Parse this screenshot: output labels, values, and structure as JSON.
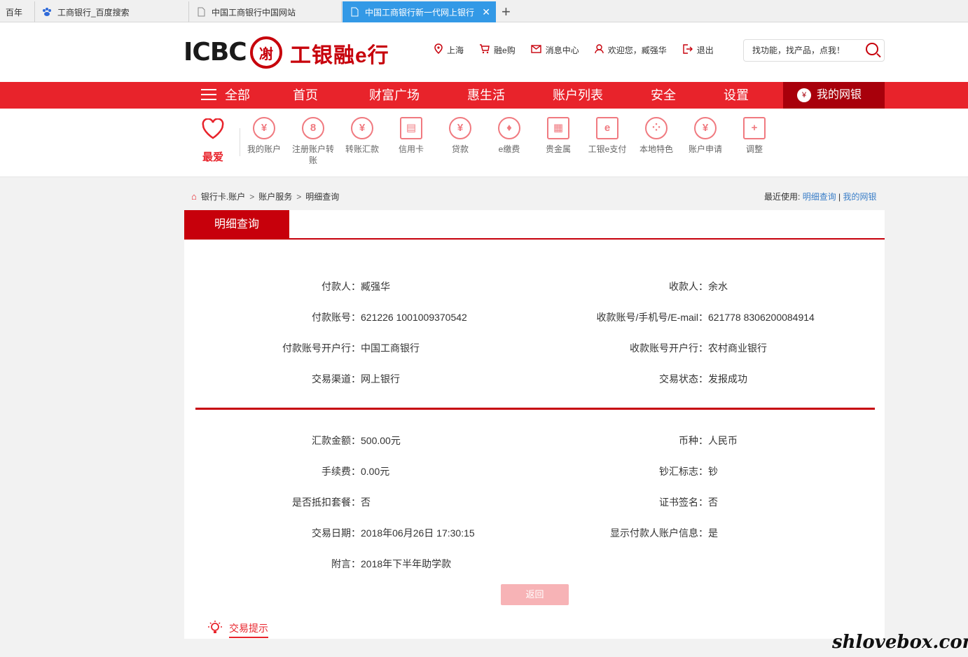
{
  "browser_tabs": [
    {
      "title": "百年"
    },
    {
      "title": "工商银行_百度搜索"
    },
    {
      "title": "中国工商银行中国网站"
    },
    {
      "title": "中国工商银行新一代网上银行",
      "active": true
    }
  ],
  "header": {
    "logo_text": "ICBC",
    "logo_seal": "㓔",
    "logo_cn": "工银融e行",
    "links": [
      {
        "icon": "location-icon",
        "label": "上海"
      },
      {
        "icon": "cart-icon",
        "label": "融e购"
      },
      {
        "icon": "mail-icon",
        "label": "消息中心"
      },
      {
        "icon": "user-icon",
        "label": "欢迎您，臧强华"
      },
      {
        "icon": "logout-icon",
        "label": "退出"
      }
    ],
    "search_placeholder": "找功能，找产品，点我！"
  },
  "nav": {
    "all": "全部",
    "items": [
      "首页",
      "财富广场",
      "惠生活",
      "账户列表",
      "安全",
      "设置"
    ],
    "my_bank": "我的网银"
  },
  "shortcuts": {
    "favorite": "最爱",
    "items": [
      {
        "label": "我的账户",
        "icon": "yuan-icon"
      },
      {
        "label": "注册账户转账",
        "icon": "transfer-icon"
      },
      {
        "label": "转账汇款",
        "icon": "yuan-cycle-icon"
      },
      {
        "label": "信用卡",
        "icon": "card-icon"
      },
      {
        "label": "贷款",
        "icon": "moneybag-icon"
      },
      {
        "label": "e缴费",
        "icon": "drop-icon"
      },
      {
        "label": "贵金属",
        "icon": "gold-icon"
      },
      {
        "label": "工银e支付",
        "icon": "epay-icon"
      },
      {
        "label": "本地特色",
        "icon": "local-icon"
      },
      {
        "label": "账户申请",
        "icon": "apply-icon"
      },
      {
        "label": "调整",
        "icon": "plus-icon"
      }
    ]
  },
  "breadcrumb": [
    "银行卡.账户",
    "账户服务",
    "明细查询"
  ],
  "recent": {
    "label": "最近使用:",
    "items": [
      "明细查询",
      "我的网银"
    ]
  },
  "panel": {
    "tab": "明细查询",
    "section1": [
      {
        "left_label": "付款人：",
        "left_value": "臧强华",
        "right_label": "收款人：",
        "right_value": "余水"
      },
      {
        "left_label": "付款账号：",
        "left_value": "621226 1001009370542",
        "right_label": "收款账号/手机号/E-mail：",
        "right_value": "621778 8306200084914"
      },
      {
        "left_label": "付款账号开户行：",
        "left_value": "中国工商银行",
        "right_label": "收款账号开户行：",
        "right_value": "农村商业银行"
      },
      {
        "left_label": "交易渠道：",
        "left_value": "网上银行",
        "right_label": "交易状态：",
        "right_value": "发报成功"
      }
    ],
    "section2": [
      {
        "left_label": "汇款金额：",
        "left_value": "500.00元",
        "right_label": "币种：",
        "right_value": "人民币"
      },
      {
        "left_label": "手续费：",
        "left_value": "0.00元",
        "right_label": "钞汇标志：",
        "right_value": "钞"
      },
      {
        "left_label": "是否抵扣套餐：",
        "left_value": "否",
        "right_label": "证书签名：",
        "right_value": "否"
      },
      {
        "left_label": "交易日期：",
        "left_value": "2018年06月26日 17:30:15",
        "right_label": "显示付款人账户信息：",
        "right_value": "是"
      },
      {
        "left_label": "附言：",
        "left_value": "2018年下半年助学款",
        "right_label": "",
        "right_value": ""
      }
    ],
    "back_button": "返回",
    "tips": "交易提示"
  },
  "watermark": "shlovebox.com",
  "colors": {
    "brand_red": "#e8232b",
    "dark_red": "#c7000b",
    "link_blue": "#3a7ec8"
  }
}
